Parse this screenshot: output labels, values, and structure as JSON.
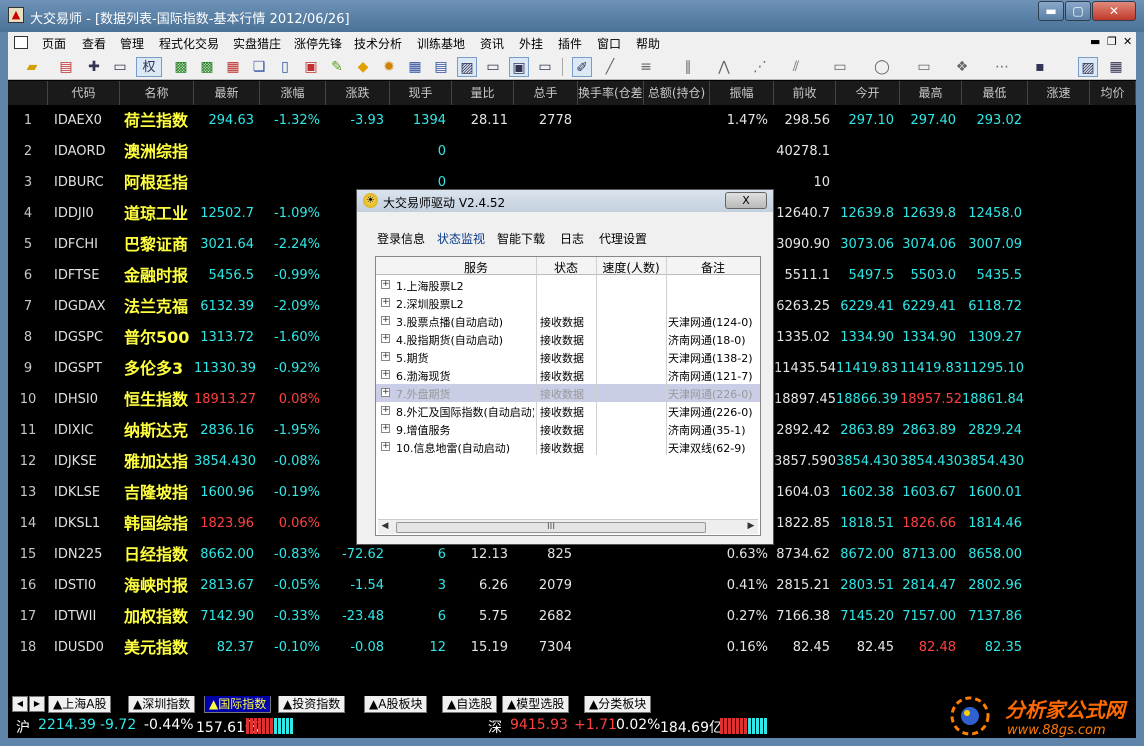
{
  "window": {
    "title": "大交易师 - [数据列表-国际指数-基本行情 2012/06/26]"
  },
  "menu": [
    "页面",
    "查看",
    "管理",
    "程式化交易",
    "实盘猎庄",
    "涨停先锋",
    "技术分析",
    "训练基地",
    "资讯",
    "外挂",
    "插件",
    "窗口",
    "帮助"
  ],
  "toolbar": {
    "quan_label": "权"
  },
  "table": {
    "columns": [
      "",
      "代码",
      "名称",
      "最新",
      "涨幅",
      "涨跌",
      "现手",
      "量比",
      "总手",
      "换手率(仓差)",
      "总额(持仓)",
      "振幅",
      "前收",
      "今开",
      "最高",
      "最低",
      "涨速",
      "均价"
    ],
    "rows": [
      {
        "idx": "1",
        "code": "IDAEX0",
        "name": "荷兰指数",
        "last": "294.63",
        "pct": "-1.32%",
        "chg": "-3.93",
        "vol": "1394",
        "ratio": "28.11",
        "total": "2778",
        "turn": "",
        "amt": "",
        "amp": "1.47%",
        "prev": "298.56",
        "open": "297.10",
        "high": "297.40",
        "low": "293.02",
        "speed": "",
        "avg": "",
        "dir": "dn",
        "odir": "dn",
        "hdir": "dn",
        "ldir": "dn"
      },
      {
        "idx": "2",
        "code": "IDAORD",
        "name": "澳洲综指",
        "last": "",
        "pct": "",
        "chg": "",
        "vol": "0",
        "ratio": "",
        "total": "",
        "turn": "",
        "amt": "",
        "amp": "",
        "prev": "40278.1",
        "open": "",
        "high": "",
        "low": "",
        "speed": "",
        "avg": "",
        "dir": "dn",
        "odir": "dn",
        "hdir": "dn",
        "ldir": "dn"
      },
      {
        "idx": "3",
        "code": "IDBURC",
        "name": "阿根廷指",
        "last": "",
        "pct": "",
        "chg": "",
        "vol": "0",
        "ratio": "",
        "total": "",
        "turn": "",
        "amt": "",
        "amp": "",
        "prev": "10",
        "open": "",
        "high": "",
        "low": "",
        "speed": "",
        "avg": "",
        "dir": "dn",
        "odir": "dn",
        "hdir": "dn",
        "ldir": "dn"
      },
      {
        "idx": "4",
        "code": "IDDJI0",
        "name": "道琼工业",
        "last": "12502.7",
        "pct": "-1.09%",
        "chg": "-1",
        "vol": "",
        "ratio": "",
        "total": "",
        "turn": "",
        "amt": "",
        "amp": "",
        "prev": "12640.7",
        "open": "12639.8",
        "high": "12639.8",
        "low": "12458.0",
        "speed": "",
        "avg": "",
        "dir": "dn",
        "odir": "dn",
        "hdir": "dn",
        "ldir": "dn"
      },
      {
        "idx": "5",
        "code": "IDFCHI",
        "name": "巴黎证商",
        "last": "3021.64",
        "pct": "-2.24%",
        "chg": "-6",
        "vol": "",
        "ratio": "",
        "total": "",
        "turn": "",
        "amt": "",
        "amp": "",
        "prev": "3090.90",
        "open": "3073.06",
        "high": "3074.06",
        "low": "3007.09",
        "speed": "",
        "avg": "",
        "dir": "dn",
        "odir": "dn",
        "hdir": "dn",
        "ldir": "dn"
      },
      {
        "idx": "6",
        "code": "IDFTSE",
        "name": "金融时报",
        "last": "5456.5",
        "pct": "-0.99%",
        "chg": "-",
        "vol": "",
        "ratio": "",
        "total": "",
        "turn": "",
        "amt": "",
        "amp": "",
        "prev": "5511.1",
        "open": "5497.5",
        "high": "5503.0",
        "low": "5435.5",
        "speed": "",
        "avg": "",
        "dir": "dn",
        "odir": "dn",
        "hdir": "dn",
        "ldir": "dn"
      },
      {
        "idx": "7",
        "code": "IDGDAX",
        "name": "法兰克福",
        "last": "6132.39",
        "pct": "-2.09%",
        "chg": "-13",
        "vol": "",
        "ratio": "",
        "total": "",
        "turn": "",
        "amt": "",
        "amp": "",
        "prev": "6263.25",
        "open": "6229.41",
        "high": "6229.41",
        "low": "6118.72",
        "speed": "",
        "avg": "",
        "dir": "dn",
        "odir": "dn",
        "hdir": "dn",
        "ldir": "dn"
      },
      {
        "idx": "8",
        "code": "IDGSPC",
        "name": "普尔500",
        "last": "1313.72",
        "pct": "-1.60%",
        "chg": "-2",
        "vol": "",
        "ratio": "",
        "total": "",
        "turn": "",
        "amt": "",
        "amp": "",
        "prev": "1335.02",
        "open": "1334.90",
        "high": "1334.90",
        "low": "1309.27",
        "speed": "",
        "avg": "",
        "dir": "dn",
        "odir": "dn",
        "hdir": "dn",
        "ldir": "dn"
      },
      {
        "idx": "9",
        "code": "IDGSPT",
        "name": "多伦多3",
        "last": "11330.39",
        "pct": "-0.92%",
        "chg": "-10",
        "vol": "",
        "ratio": "",
        "total": "",
        "turn": "",
        "amt": "",
        "amp": "",
        "prev": "11435.54",
        "open": "11419.83",
        "high": "11419.83",
        "low": "11295.10",
        "speed": "",
        "avg": "",
        "dir": "dn",
        "odir": "dn",
        "hdir": "dn",
        "ldir": "dn"
      },
      {
        "idx": "10",
        "code": "IDHSI0",
        "name": "恒生指数",
        "last": "18913.27",
        "pct": "0.08%",
        "chg": "1",
        "vol": "",
        "ratio": "",
        "total": "",
        "turn": "",
        "amt": "",
        "amp": "",
        "prev": "18897.45",
        "open": "18866.39",
        "high": "18957.52",
        "low": "18861.84",
        "speed": "",
        "avg": "",
        "dir": "up",
        "odir": "dn",
        "hdir": "up",
        "ldir": "dn"
      },
      {
        "idx": "11",
        "code": "IDIXIC",
        "name": "纳斯达克",
        "last": "2836.16",
        "pct": "-1.95%",
        "chg": "-5",
        "vol": "",
        "ratio": "",
        "total": "",
        "turn": "",
        "amt": "",
        "amp": "",
        "prev": "2892.42",
        "open": "2863.89",
        "high": "2863.89",
        "low": "2829.24",
        "speed": "",
        "avg": "",
        "dir": "dn",
        "odir": "dn",
        "hdir": "dn",
        "ldir": "dn"
      },
      {
        "idx": "12",
        "code": "IDJKSE",
        "name": "雅加达指",
        "last": "3854.430",
        "pct": "-0.08%",
        "chg": "-3",
        "vol": "",
        "ratio": "",
        "total": "",
        "turn": "",
        "amt": "",
        "amp": "",
        "prev": "3857.590",
        "open": "3854.430",
        "high": "3854.430",
        "low": "3854.430",
        "speed": "",
        "avg": "",
        "dir": "dn",
        "odir": "dn",
        "hdir": "dn",
        "ldir": "dn"
      },
      {
        "idx": "13",
        "code": "IDKLSE",
        "name": "吉隆坡指",
        "last": "1600.96",
        "pct": "-0.19%",
        "chg": "-",
        "vol": "",
        "ratio": "",
        "total": "",
        "turn": "",
        "amt": "",
        "amp": "",
        "prev": "1604.03",
        "open": "1602.38",
        "high": "1603.67",
        "low": "1600.01",
        "speed": "",
        "avg": "",
        "dir": "dn",
        "odir": "dn",
        "hdir": "dn",
        "ldir": "dn"
      },
      {
        "idx": "14",
        "code": "IDKSL1",
        "name": "韩国综指",
        "last": "1823.96",
        "pct": "0.06%",
        "chg": "",
        "vol": "",
        "ratio": "",
        "total": "",
        "turn": "",
        "amt": "",
        "amp": "",
        "prev": "1822.85",
        "open": "1818.51",
        "high": "1826.66",
        "low": "1814.46",
        "speed": "",
        "avg": "",
        "dir": "up",
        "odir": "dn",
        "hdir": "up",
        "ldir": "dn"
      },
      {
        "idx": "15",
        "code": "IDN225",
        "name": "日经指数",
        "last": "8662.00",
        "pct": "-0.83%",
        "chg": "-72.62",
        "vol": "6",
        "ratio": "12.13",
        "total": "825",
        "turn": "",
        "amt": "",
        "amp": "0.63%",
        "prev": "8734.62",
        "open": "8672.00",
        "high": "8713.00",
        "low": "8658.00",
        "speed": "",
        "avg": "",
        "dir": "dn",
        "odir": "dn",
        "hdir": "dn",
        "ldir": "dn"
      },
      {
        "idx": "16",
        "code": "IDSTI0",
        "name": "海峡时报",
        "last": "2813.67",
        "pct": "-0.05%",
        "chg": "-1.54",
        "vol": "3",
        "ratio": "6.26",
        "total": "2079",
        "turn": "",
        "amt": "",
        "amp": "0.41%",
        "prev": "2815.21",
        "open": "2803.51",
        "high": "2814.47",
        "low": "2802.96",
        "speed": "",
        "avg": "",
        "dir": "dn",
        "odir": "dn",
        "hdir": "dn",
        "ldir": "dn"
      },
      {
        "idx": "17",
        "code": "IDTWII",
        "name": "加权指数",
        "last": "7142.90",
        "pct": "-0.33%",
        "chg": "-23.48",
        "vol": "6",
        "ratio": "5.75",
        "total": "2682",
        "turn": "",
        "amt": "",
        "amp": "0.27%",
        "prev": "7166.38",
        "open": "7145.20",
        "high": "7157.00",
        "low": "7137.86",
        "speed": "",
        "avg": "",
        "dir": "dn",
        "odir": "dn",
        "hdir": "dn",
        "ldir": "dn"
      },
      {
        "idx": "18",
        "code": "IDUSD0",
        "name": "美元指数",
        "last": "82.37",
        "pct": "-0.10%",
        "chg": "-0.08",
        "vol": "12",
        "ratio": "15.19",
        "total": "7304",
        "turn": "",
        "amt": "",
        "amp": "0.16%",
        "prev": "82.45",
        "open": "82.45",
        "high": "82.48",
        "low": "82.35",
        "speed": "",
        "avg": "",
        "dir": "dn",
        "odir": "wh",
        "hdir": "up",
        "ldir": "dn"
      }
    ]
  },
  "dialog": {
    "title": "大交易师驱动 V2.4.52",
    "close_label": "X",
    "tabs": [
      "登录信息",
      "状态监视",
      "智能下载",
      "日志",
      "代理设置"
    ],
    "columns": [
      "服务",
      "状态",
      "速度(人数)",
      "备注"
    ],
    "services": [
      {
        "name": "1.上海股票L2",
        "status": "",
        "speed": "",
        "note": ""
      },
      {
        "name": "2.深圳股票L2",
        "status": "",
        "speed": "",
        "note": ""
      },
      {
        "name": "3.股票点播(自动启动)",
        "status": "接收数据",
        "speed": "",
        "note": "天津网通(124-0)"
      },
      {
        "name": "4.股指期货(自动启动)",
        "status": "接收数据",
        "speed": "",
        "note": "济南网通(18-0)"
      },
      {
        "name": "5.期货",
        "status": "接收数据",
        "speed": "",
        "note": "天津网通(138-2)"
      },
      {
        "name": "6.渤海现货",
        "status": "接收数据",
        "speed": "",
        "note": "济南网通(121-7)"
      },
      {
        "name": "7.外盘期货",
        "status": "接收数据",
        "speed": "",
        "note": "天津网通(226-0)"
      },
      {
        "name": "8.外汇及国际指数(自动启动)",
        "status": "接收数据",
        "speed": "",
        "note": "天津网通(226-0)"
      },
      {
        "name": "9.增值服务",
        "status": "接收数据",
        "speed": "",
        "note": "济南网通(35-1)"
      },
      {
        "name": "10.信息地雷(自动启动)",
        "status": "接收数据",
        "speed": "",
        "note": "天津双线(62-9)"
      }
    ],
    "scroll_thumb": "III"
  },
  "sheets": [
    "上海A股",
    "深圳指数",
    "国际指数",
    "投资指数",
    "A股板块",
    "自选股",
    "模型选股",
    "分类板块"
  ],
  "status": {
    "sh_label": "沪",
    "sh_index": "2214.39",
    "sh_chg": "-9.72",
    "sh_pct": "-0.44%",
    "sh_amt": "157.61亿",
    "sz_label": "深",
    "sz_index": "9415.93",
    "sz_chg": "+1.71",
    "sz_pct": "0.02%",
    "sz_amt": "184.69亿"
  },
  "brand": {
    "name": "分析家公式网",
    "url": "www.88gs.com"
  },
  "colors": {
    "up": "#ff4040",
    "down": "#30e8e8",
    "name": "#ffff40",
    "active_sheet": "#0000a8"
  }
}
